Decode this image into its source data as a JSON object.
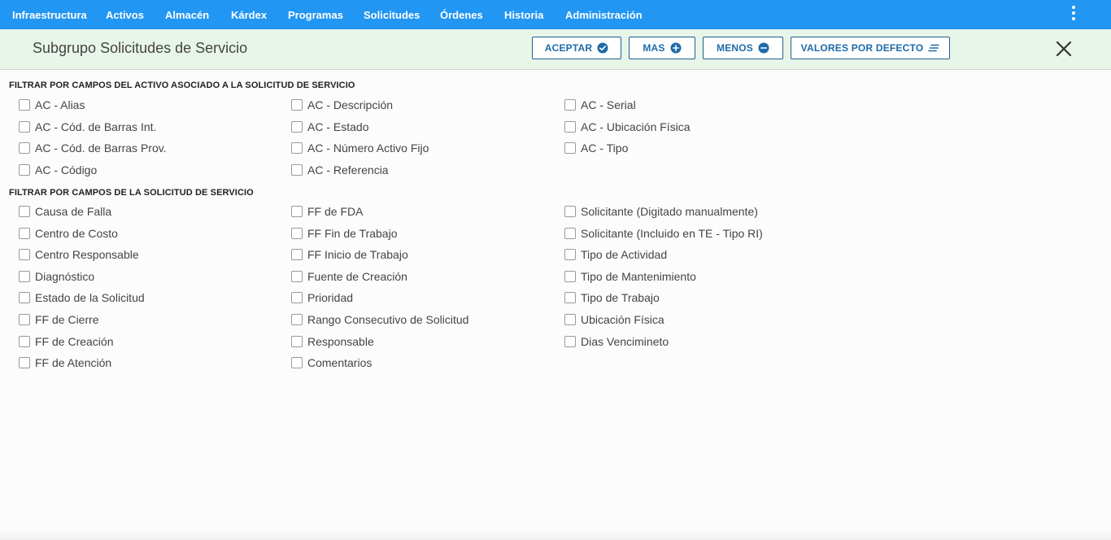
{
  "nav": {
    "items": [
      "Infraestructura",
      "Activos",
      "Almacén",
      "Kárdex",
      "Programas",
      "Solicitudes",
      "Órdenes",
      "Historia",
      "Administración"
    ]
  },
  "header": {
    "title": "Subgrupo Solicitudes de Servicio",
    "buttons": {
      "accept": "ACEPTAR",
      "more": "MAS",
      "less": "MENOS",
      "defaults": "VALORES POR DEFECTO"
    }
  },
  "sections": [
    {
      "title": "FILTRAR POR CAMPOS DEL ACTIVO ASOCIADO A LA SOLICITUD DE SERVICIO",
      "columns": [
        [
          "AC - Alias",
          "AC - Cód. de Barras Int.",
          "AC - Cód. de Barras Prov.",
          "AC - Código"
        ],
        [
          "AC - Descripción",
          "AC - Estado",
          "AC - Número Activo Fijo",
          "AC - Referencia"
        ],
        [
          "AC - Serial",
          "AC - Ubicación Física",
          "AC - Tipo"
        ]
      ]
    },
    {
      "title": "FILTRAR POR CAMPOS DE LA SOLICITUD DE SERVICIO",
      "columns": [
        [
          "Causa de Falla",
          "Centro de Costo",
          "Centro Responsable",
          "Diagnóstico",
          "Estado de la Solicitud",
          "FF de Cierre",
          "FF de Creación",
          "FF de Atención"
        ],
        [
          "FF de FDA",
          "FF Fin de Trabajo",
          "FF Inicio de Trabajo",
          "Fuente de Creación",
          "Prioridad",
          "Rango Consecutivo de Solicitud",
          "Responsable",
          "Comentarios"
        ],
        [
          "Solicitante (Digitado manualmente)",
          "Solicitante (Incluido en TE - Tipo RI)",
          "Tipo de Actividad",
          "Tipo de Mantenimiento",
          "Tipo de Trabajo",
          "Ubicación Física",
          "Dias Vencimineto"
        ]
      ]
    }
  ],
  "colors": {
    "nav_bg": "#2196f3",
    "subbar_bg": "#e8f5e9",
    "button_text": "#1e6aa8"
  },
  "icons": {
    "accept": "check-circle-icon",
    "more": "plus-circle-icon",
    "less": "minus-circle-icon",
    "defaults": "lines-icon",
    "close": "close-icon",
    "menu": "more-vertical-icon"
  }
}
